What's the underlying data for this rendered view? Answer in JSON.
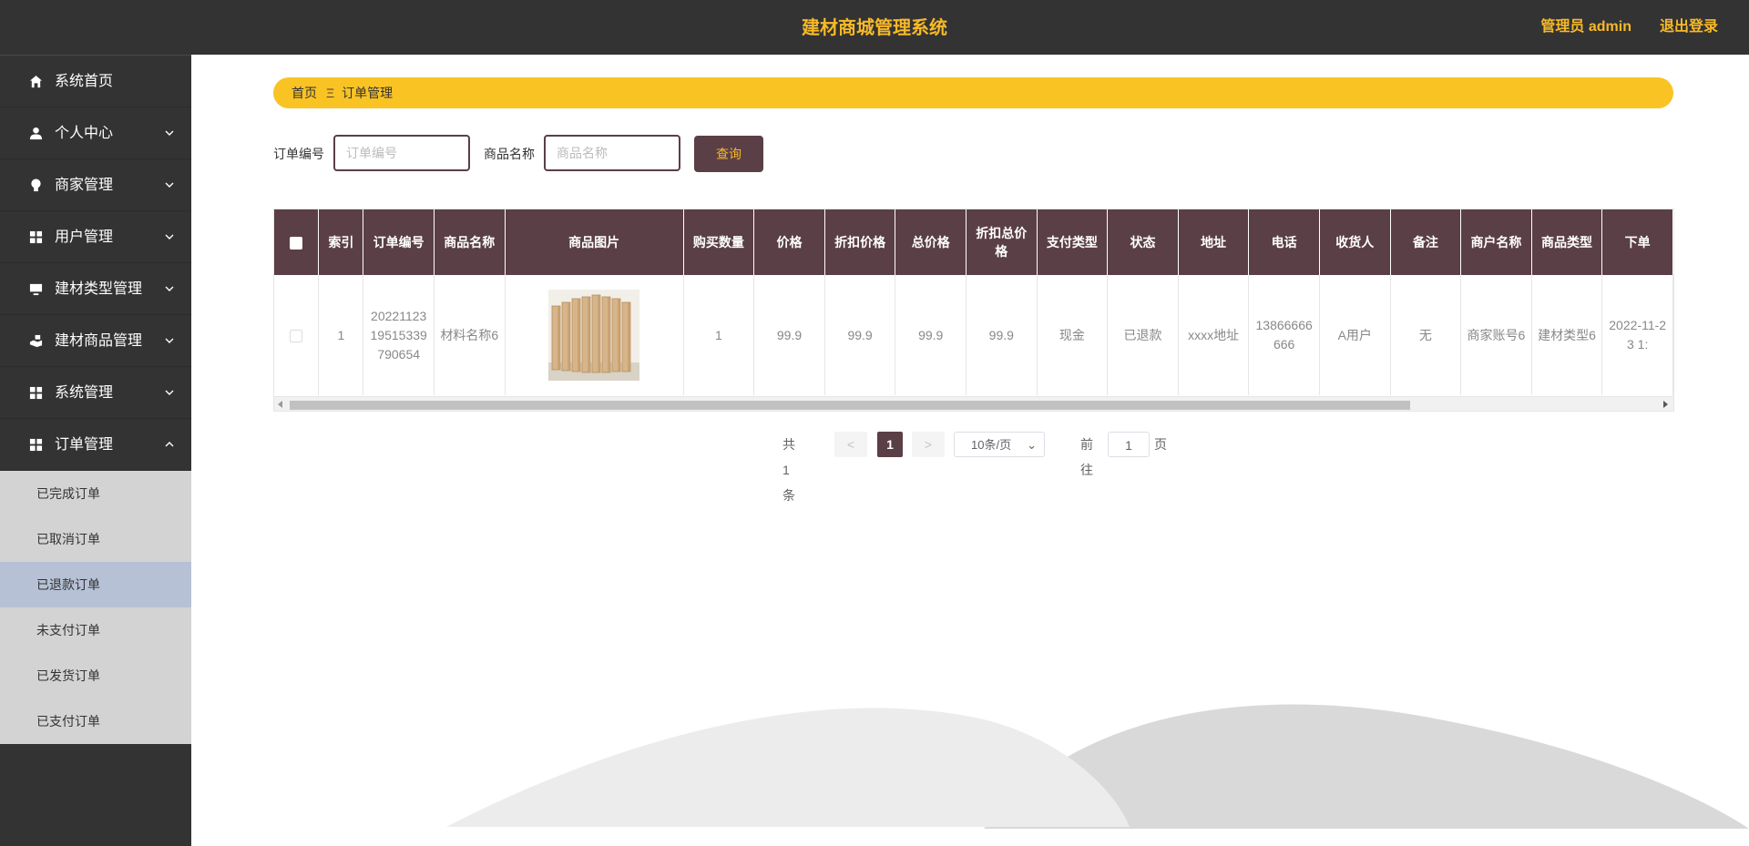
{
  "header": {
    "title": "建材商城管理系统",
    "admin_label": "管理员 admin",
    "logout_label": "退出登录"
  },
  "sidebar": {
    "items": [
      {
        "label": "系统首页",
        "icon": "home-icon"
      },
      {
        "label": "个人中心",
        "icon": "user-icon"
      },
      {
        "label": "商家管理",
        "icon": "bulb-icon"
      },
      {
        "label": "用户管理",
        "icon": "grid-icon"
      },
      {
        "label": "建材类型管理",
        "icon": "monitor-icon"
      },
      {
        "label": "建材商品管理",
        "icon": "hand-icon"
      },
      {
        "label": "系统管理",
        "icon": "grid-icon"
      },
      {
        "label": "订单管理",
        "icon": "grid-icon"
      }
    ],
    "subitems": [
      {
        "label": "已完成订单"
      },
      {
        "label": "已取消订单"
      },
      {
        "label": "已退款订单"
      },
      {
        "label": "未支付订单"
      },
      {
        "label": "已发货订单"
      },
      {
        "label": "已支付订单"
      }
    ]
  },
  "breadcrumb": {
    "home": "首页",
    "separator": "Ξ",
    "current": "订单管理"
  },
  "search": {
    "order_no_label": "订单编号",
    "order_no_placeholder": "订单编号",
    "product_name_label": "商品名称",
    "product_name_placeholder": "商品名称",
    "query_button": "查询"
  },
  "table": {
    "headers": [
      "索引",
      "订单编号",
      "商品名称",
      "商品图片",
      "购买数量",
      "价格",
      "折扣价格",
      "总价格",
      "折扣总价格",
      "支付类型",
      "状态",
      "地址",
      "电话",
      "收货人",
      "备注",
      "商户名称",
      "商品类型",
      "下单"
    ],
    "row": {
      "index": "1",
      "order_no": "20221123195153397906​54",
      "product_name": "材料名称6",
      "quantity": "1",
      "price": "99.9",
      "discount_price": "99.9",
      "total_price": "99.9",
      "discount_total": "99.9",
      "pay_type": "现金",
      "status": "已退款",
      "address": "xxxx地址",
      "phone": "13866666666",
      "receiver": "A用户",
      "remark": "无",
      "merchant": "商家账号6",
      "product_type": "建材类型6",
      "order_time": "2022-11-23 1:"
    }
  },
  "pagination": {
    "total": "共 1 条",
    "prev": "<",
    "current_page": "1",
    "next": ">",
    "page_size": "10条/页",
    "goto_label": "前往",
    "goto_value": "1",
    "page_suffix": "页"
  },
  "colors": {
    "dark": "#333333",
    "accent": "#f7b928",
    "breadcrumb_bg": "#f9c324",
    "primary": "#5a3f46",
    "submenu_bg": "#d3d3d3",
    "submenu_active": "#b6c1d6"
  }
}
